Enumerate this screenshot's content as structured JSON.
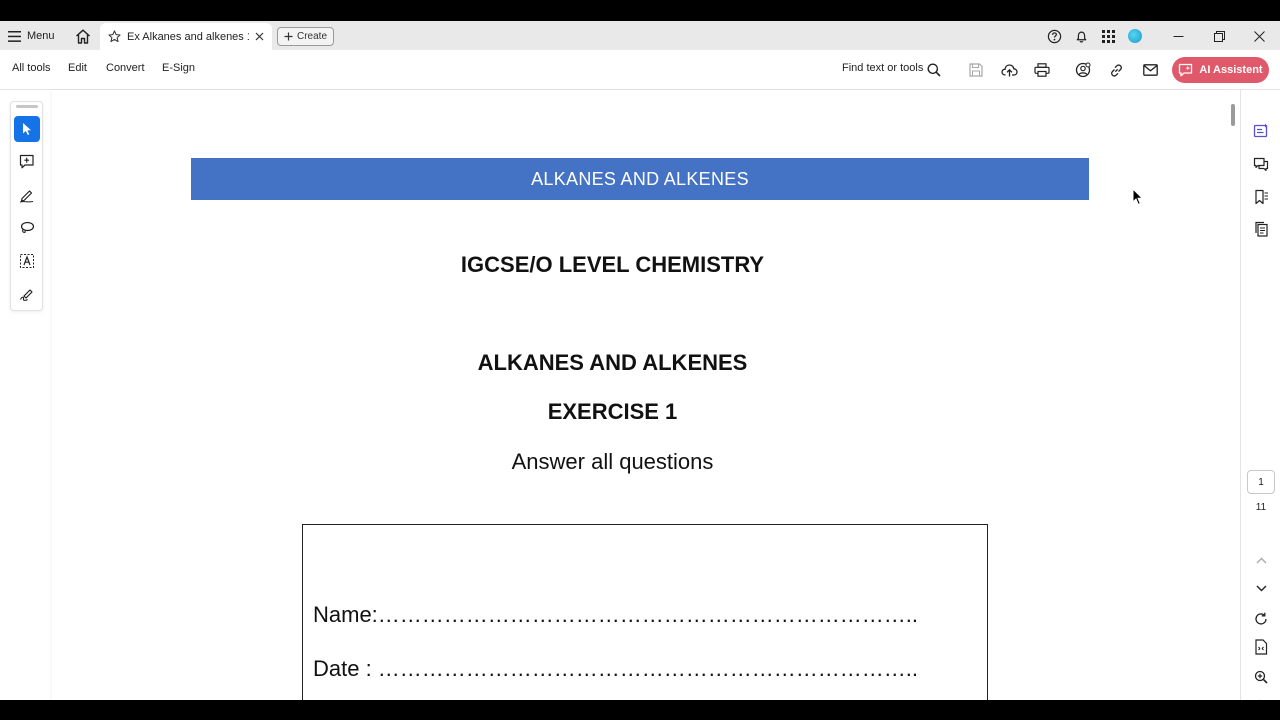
{
  "titlebar": {
    "menu_label": "Menu",
    "tab_title": "Ex Alkanes and alkenes 1...",
    "create_label": "Create"
  },
  "toolbar": {
    "all_tools": "All tools",
    "edit": "Edit",
    "convert": "Convert",
    "esign": "E-Sign",
    "find_label": "Find text or tools",
    "ai_assistant": "AI Assistent"
  },
  "document": {
    "banner": "ALKANES AND ALKENES",
    "subject": "IGCSE/O LEVEL CHEMISTRY",
    "topic": "ALKANES AND ALKENES",
    "exercise": "EXERCISE 1",
    "instruction": "Answer all questions",
    "name_line": "Name:………………………………………………………………..",
    "date_line": "Date : ……………………………………………………………….."
  },
  "navigation": {
    "current_page": "1",
    "total_pages": "11"
  },
  "colors": {
    "banner": "#4472c4",
    "accent_blue": "#1473e6",
    "ai_button": "#e0596a"
  }
}
